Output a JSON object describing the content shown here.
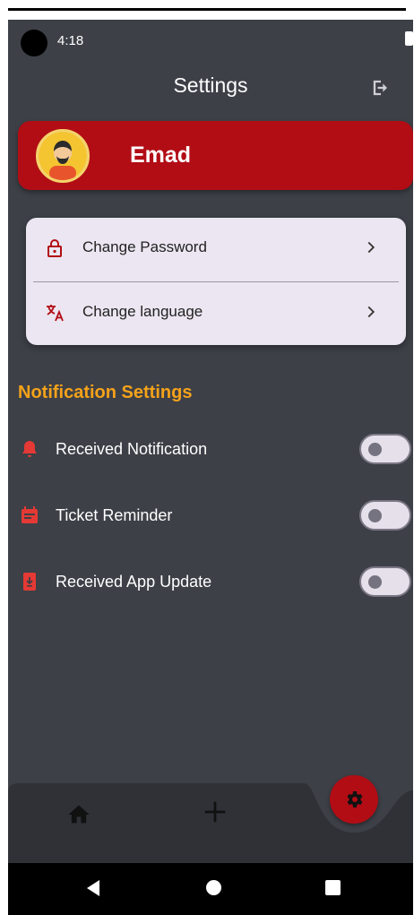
{
  "status_bar": {
    "time": "4:18"
  },
  "header": {
    "title": "Settings",
    "logout_icon": "logout-icon"
  },
  "profile": {
    "name": "Emad",
    "avatar_icon": "user-avatar"
  },
  "account": {
    "items": [
      {
        "label": "Change Password",
        "icon": "lock-icon"
      },
      {
        "label": "Change language",
        "icon": "translate-icon"
      }
    ]
  },
  "notifications": {
    "title": "Notification Settings",
    "items": [
      {
        "label": "Received Notification",
        "icon": "bell-icon",
        "enabled": false
      },
      {
        "label": "Ticket Reminder",
        "icon": "calendar-icon",
        "enabled": false
      },
      {
        "label": "Received App Update",
        "icon": "phone-download-icon",
        "enabled": false
      }
    ]
  },
  "bottom_nav": {
    "items": [
      {
        "icon": "home-icon"
      },
      {
        "icon": "add-icon"
      },
      {
        "icon": "settings-icon",
        "active": true
      }
    ]
  },
  "colors": {
    "background": "#3d4047",
    "primary": "#b20d15",
    "accent": "#f5a21a",
    "card": "#ebe6f1",
    "icon_red": "#e53935"
  }
}
